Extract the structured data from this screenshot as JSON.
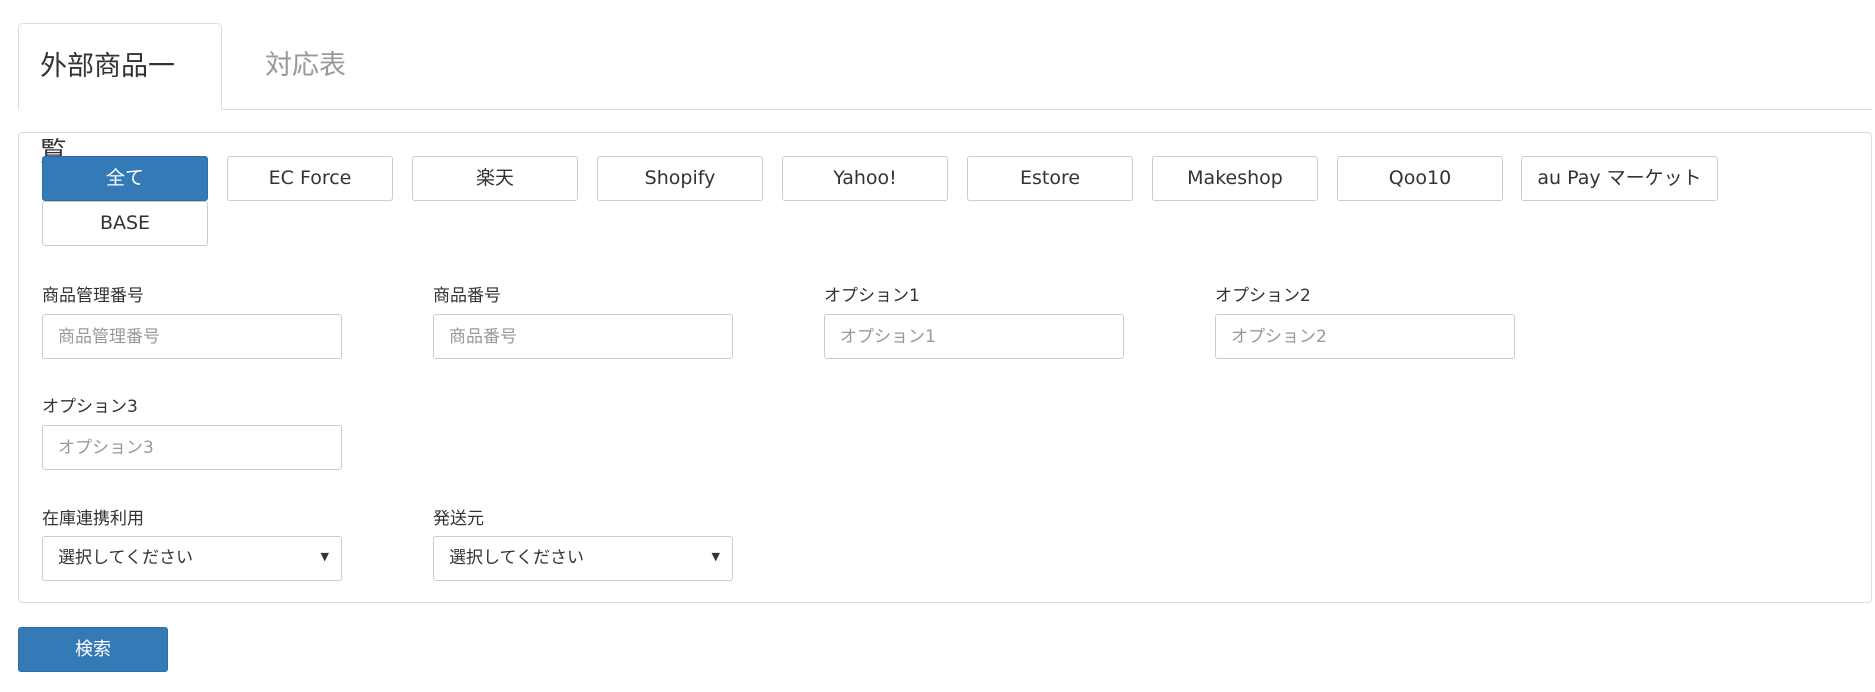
{
  "tabs": [
    {
      "label": "外部商品一覧",
      "active": true
    },
    {
      "label": "対応表",
      "active": false
    }
  ],
  "filters": {
    "selected": "全て",
    "buttons": [
      "全て",
      "EC Force",
      "楽天",
      "Shopify",
      "Yahoo!",
      "Estore",
      "Makeshop",
      "Qoo10",
      "au Pay マーケット",
      "BASE"
    ]
  },
  "fields": {
    "product_mgmt_no": {
      "label": "商品管理番号",
      "placeholder": "商品管理番号",
      "value": ""
    },
    "product_no": {
      "label": "商品番号",
      "placeholder": "商品番号",
      "value": ""
    },
    "option1": {
      "label": "オプション1",
      "placeholder": "オプション1",
      "value": ""
    },
    "option2": {
      "label": "オプション2",
      "placeholder": "オプション2",
      "value": ""
    },
    "option3": {
      "label": "オプション3",
      "placeholder": "オプション3",
      "value": ""
    },
    "stock_link": {
      "label": "在庫連携利用",
      "selected": "選択してください",
      "arrow_icon": "caret-down-icon"
    },
    "ship_from": {
      "label": "発送元",
      "selected": "選択してください",
      "arrow_icon": "caret-down-icon"
    }
  },
  "search_button": {
    "label": "検索"
  },
  "colors": {
    "primary": "#337ab7",
    "border": "#cccccc",
    "placeholder": "#999999",
    "inactive_tab": "#999999"
  }
}
